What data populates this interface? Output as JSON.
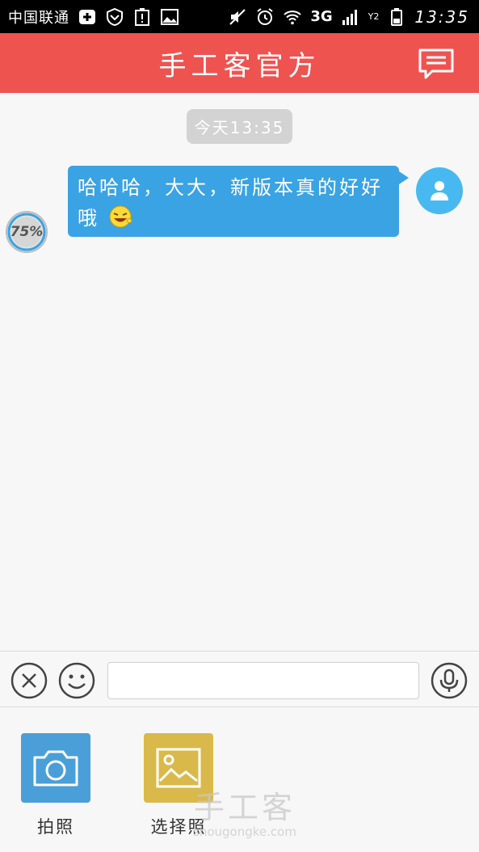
{
  "status_bar": {
    "carrier": "中国联通",
    "network": "3G",
    "sim2": "Y2",
    "time": "13:35"
  },
  "header": {
    "title": "手工客官方",
    "message_icon": "message-icon"
  },
  "chat": {
    "timestamp": "今天13:35",
    "messages": [
      {
        "text": "哈哈哈，大大，新版本真的好好哦",
        "emoji": "laughing-emoji",
        "sender": "self",
        "upload_progress": "75%"
      }
    ]
  },
  "input_bar": {
    "value": "",
    "placeholder": "",
    "icons": [
      "close-icon",
      "emoji-icon",
      "microphone-icon"
    ]
  },
  "attach_panel": {
    "items": [
      {
        "label": "拍照",
        "icon": "camera-icon",
        "color": "#4a9fd8"
      },
      {
        "label": "选择照",
        "icon": "image-icon",
        "color": "#d9b94a"
      }
    ]
  },
  "watermark": {
    "brand": "手工客",
    "url": "shougongke.com"
  },
  "colors": {
    "header_bg": "#ef5350",
    "bubble_bg": "#3aa3e3",
    "avatar_bg": "#48b9f0"
  }
}
